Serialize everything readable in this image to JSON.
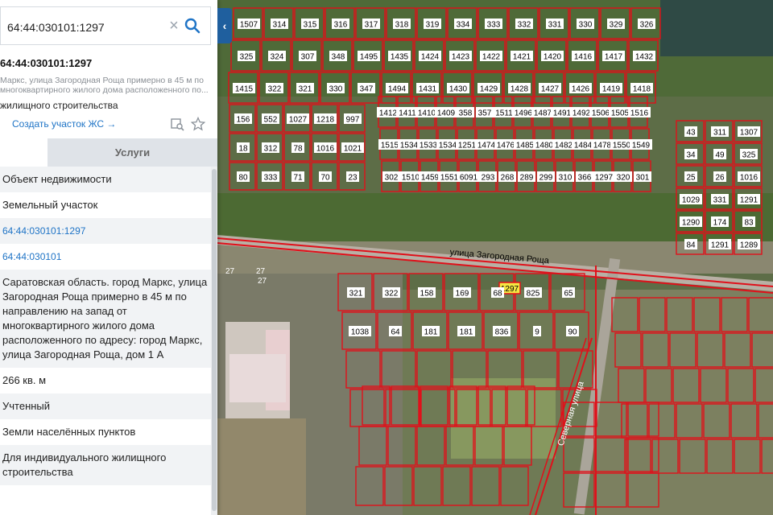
{
  "search": {
    "value": "64:44:030101:1297",
    "clear_symbol": "×"
  },
  "collapse_symbol": "‹",
  "object": {
    "title": "64:44:030101:1297",
    "description_line1": "Маркс, улица Загородная Роща примерно в 45 м по",
    "description_line2": "многоквартирного жилого дома расположенного по...",
    "purpose": "жилищного строительства",
    "create_link": "Создать участок ЖС →"
  },
  "tabs": {
    "services": "Услуги"
  },
  "details": [
    "Объект недвижимости",
    "Земельный участок",
    "64:44:030101:1297",
    "64:44:030101",
    "Саратовская область. город Маркс, улица Загородная Роща примерно в 45 м по направлению на запад от многоквартирного жилого дома расположенного по адресу: город Маркс, улица Загородная Роща, дом 1 А",
    "266 кв. м",
    "Учтенный",
    "Земли населённых пунктов",
    "Для индивидуального жилищного строительства"
  ],
  "map": {
    "streets": [
      "улица Загородная Роща",
      "Северная улица"
    ],
    "highlighted_parcel": "1297",
    "parcel_labels": [
      "1507",
      "314",
      "315",
      "316",
      "317",
      "318",
      "319",
      "334",
      "333",
      "332",
      "331",
      "330",
      "329",
      "326",
      "325",
      "324",
      "307",
      "348",
      "1495",
      "1435",
      "1424",
      "1423",
      "1422",
      "1421",
      "1420",
      "1416",
      "1417",
      "1432",
      "1415",
      "322",
      "321",
      "330",
      "347",
      "1494",
      "1431",
      "1430",
      "1429",
      "1428",
      "1427",
      "1426",
      "1419",
      "1418",
      "1412",
      "1411",
      "1410",
      "1409",
      "358",
      "357",
      "1511",
      "1496",
      "1487",
      "1491",
      "1492",
      "1506",
      "1505",
      "1516",
      "1515",
      "1534",
      "1533",
      "1534",
      "1251",
      "1474",
      "1476",
      "1485",
      "1480",
      "1482",
      "1484",
      "1478",
      "1550",
      "1549",
      "302",
      "1510",
      "1459",
      "1551",
      "6091",
      "293",
      "268",
      "289",
      "299",
      "310",
      "366",
      "1297",
      "320",
      "301",
      "156",
      "552",
      "1027",
      "1218",
      "997",
      "18",
      "312",
      "78",
      "1016",
      "1021",
      "80",
      "333",
      "71",
      "70",
      "23",
      "43",
      "311",
      "1307",
      "34",
      "49",
      "325",
      "25",
      "26",
      "1016",
      "1029",
      "331",
      "1291",
      "1290",
      "174",
      "83",
      "84",
      "1291",
      "1289",
      "321",
      "322",
      "158",
      "169",
      "68",
      "825",
      "65",
      "1038",
      "64",
      "181",
      "181",
      "836",
      "9",
      "90"
    ],
    "misc_labels": [
      "27",
      "27",
      "27"
    ]
  },
  "colors": {
    "parcel_border": "#e0101a",
    "parcel_label_bg": "#ffffff",
    "highlight_fill": "#f5e642",
    "link": "#1f74c6",
    "panel_tab_bg": "#1f5f9e"
  }
}
